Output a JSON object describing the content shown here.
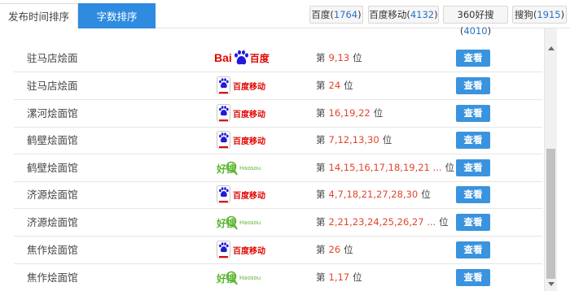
{
  "tabs": [
    {
      "label": "发布时间排序",
      "active": false
    },
    {
      "label": "字数排序",
      "active": true
    }
  ],
  "engines": [
    {
      "name": "百度",
      "count": "1764"
    },
    {
      "name": "百度移动",
      "count": "4132"
    },
    {
      "name": "360好搜",
      "count": "4010"
    },
    {
      "name": "搜狗",
      "count": "1915"
    }
  ],
  "rank_prefix": "第",
  "rank_suffix": "位",
  "view_label": "查看",
  "logos": {
    "baidu": {
      "text_bai": "Bai",
      "text_du": "百度",
      "icon": "baidu-paw-icon"
    },
    "baidu_mobile": {
      "text": "百度移动",
      "icon": "baidu-paw-icon"
    },
    "haosou": {
      "text_cn": "好搜",
      "text_en": "Haosou",
      "icon": "haosou-magnifier-icon"
    }
  },
  "rows": [
    {
      "keyword": "驻马店烩面",
      "engine": "baidu",
      "positions": "9,13"
    },
    {
      "keyword": "驻马店烩面",
      "engine": "baidu_mobile",
      "positions": "24"
    },
    {
      "keyword": "漯河烩面馆",
      "engine": "baidu_mobile",
      "positions": "16,19,22"
    },
    {
      "keyword": "鹤壁烩面馆",
      "engine": "baidu_mobile",
      "positions": "7,12,13,30"
    },
    {
      "keyword": "鹤壁烩面馆",
      "engine": "haosou",
      "positions": "14,15,16,17,18,19,21 ..."
    },
    {
      "keyword": "济源烩面馆",
      "engine": "baidu_mobile",
      "positions": "4,7,18,21,27,28,30"
    },
    {
      "keyword": "济源烩面馆",
      "engine": "haosou",
      "positions": "2,21,23,24,25,26,27 ..."
    },
    {
      "keyword": "焦作烩面馆",
      "engine": "baidu_mobile",
      "positions": "26"
    },
    {
      "keyword": "焦作烩面馆",
      "engine": "haosou",
      "positions": "1,17"
    }
  ],
  "colors": {
    "accent": "#2e8be0",
    "button": "#3a93de",
    "rank_number": "#e0452c",
    "count": "#2a6fc9",
    "baidu_red": "#e10601",
    "baidu_blue": "#2319dc",
    "haosou_green": "#5cb531"
  }
}
